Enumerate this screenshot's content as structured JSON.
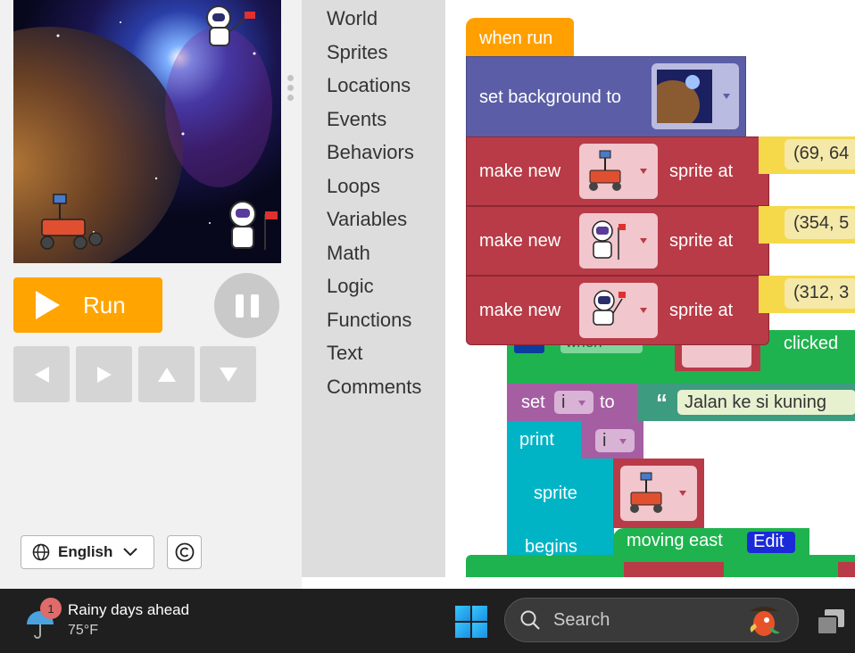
{
  "stage": {
    "run_label": "Run"
  },
  "language": {
    "selected": "English"
  },
  "toolbox": {
    "categories": [
      "World",
      "Sprites",
      "Locations",
      "Events",
      "Behaviors",
      "Loops",
      "Variables",
      "Math",
      "Logic",
      "Functions",
      "Text",
      "Comments"
    ]
  },
  "workspace": {
    "when_run": "when run",
    "set_background": "set background to",
    "make_new": "make new",
    "sprite_at": "sprite at",
    "coords": [
      "(69, 64",
      "(354, 5",
      "(312, 3"
    ],
    "when_label": "when",
    "clicked": "clicked",
    "set_label": "set",
    "var_name": "i",
    "to_label": "to",
    "string_value": "Jalan ke si kuning",
    "quote_open": "“",
    "print_label": "print",
    "sprite_label": "sprite",
    "begins_label": "begins",
    "behavior_name": "moving east",
    "edit_label": "Edit",
    "colors": {
      "event": "#ffa000",
      "world": "#5b5ea6",
      "sprites": "#b83b47",
      "sprite_event": "#1fb34f",
      "variables": "#a65ea3",
      "behaviors": "#00b4c6"
    }
  },
  "taskbar": {
    "weather_title": "Rainy days ahead",
    "weather_temp": "75°F",
    "weather_badge": "1",
    "search_placeholder": "Search"
  }
}
